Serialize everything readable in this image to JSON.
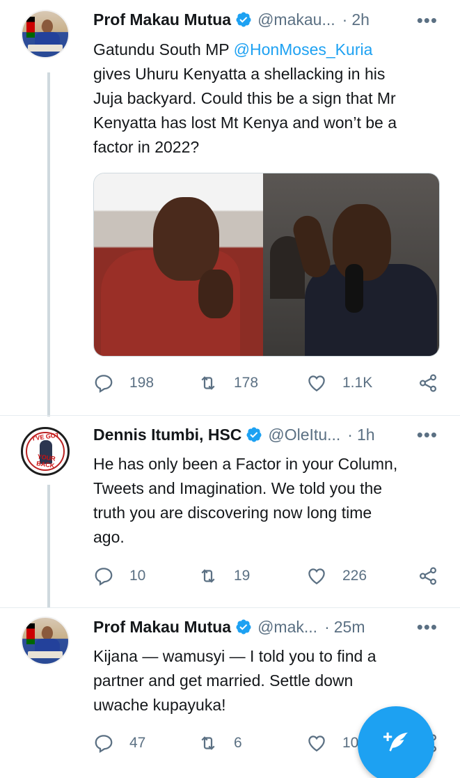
{
  "tweets": [
    {
      "name": "Prof Makau Mutua",
      "handle": "@makau...",
      "time": "2h",
      "text_lines": [
        {
          "mention": "",
          "before": "Gatundu South MP ",
          "after": "@HonMoses_Kuria"
        },
        "gives Uhuru Kenyatta a shellacking in his",
        "Juja backyard.  Could this be a sign that Mr",
        "Kenyatta has lost Mt Kenya and won’t be a",
        "factor in 2022?"
      ],
      "replies": "198",
      "retweets": "178",
      "likes": "1.1K"
    },
    {
      "name": "Dennis Itumbi, HSC",
      "handle": "@OleItu...",
      "time": "1h",
      "avatar_text_top": "I'VE GOT",
      "avatar_text_bottom": "YOUR BACK",
      "text_lines": [
        "He has only been a Factor in your Column,",
        "Tweets and Imagination. We told you the",
        "truth you are discovering now long time",
        "ago."
      ],
      "replies": "10",
      "retweets": "19",
      "likes": "226"
    },
    {
      "name": "Prof Makau Mutua",
      "handle": "@mak...",
      "time": "25m",
      "text_lines": [
        "Kijana — wamusyi — I told you to find a",
        "partner and get married.  Settle down",
        "uwache kupayuka!"
      ],
      "replies": "47",
      "retweets": "6",
      "likes": "10"
    }
  ],
  "separator": "·",
  "more": "•••",
  "colors": {
    "accent": "#1da1f2",
    "muted": "#5b7083",
    "text": "#14171a",
    "thread_line": "#cfd9de"
  },
  "icons": {
    "reply": "reply-icon",
    "retweet": "retweet-icon",
    "like": "heart-icon",
    "share": "share-icon",
    "verified": "verified-badge-icon",
    "compose": "compose-tweet-icon"
  }
}
